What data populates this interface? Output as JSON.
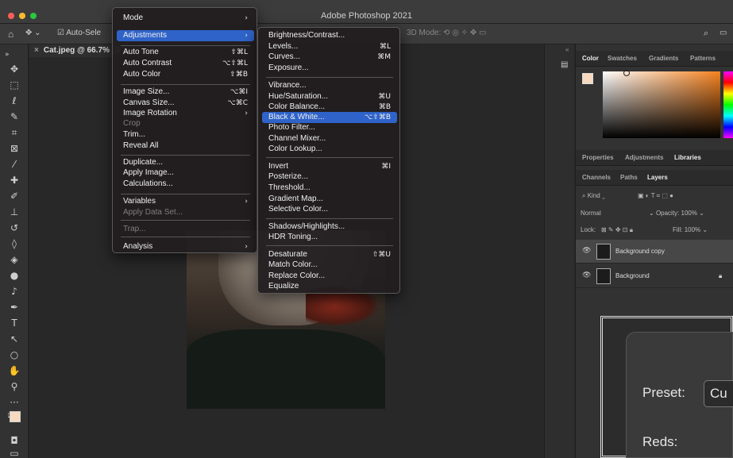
{
  "window": {
    "title": "Adobe Photoshop 2021"
  },
  "optionsbar": {
    "autoselect": "Auto-Sele",
    "mode3d": "3D Mode:"
  },
  "document": {
    "tab_title": "Cat.jpeg @ 66.7% (B"
  },
  "image_menu": {
    "items": [
      {
        "label": "Mode",
        "shortcut": "",
        "arrow": "›",
        "state": "normal"
      },
      {
        "label": "Adjustments",
        "shortcut": "",
        "arrow": "›",
        "state": "highlight"
      },
      {
        "label": "Auto Tone",
        "shortcut": "⇧⌘L",
        "arrow": "",
        "state": "normal"
      },
      {
        "label": "Auto Contrast",
        "shortcut": "⌥⇧⌘L",
        "arrow": "",
        "state": "normal"
      },
      {
        "label": "Auto Color",
        "shortcut": "⇧⌘B",
        "arrow": "",
        "state": "normal"
      },
      {
        "label": "Image Size...",
        "shortcut": "⌥⌘I",
        "arrow": "",
        "state": "normal"
      },
      {
        "label": "Canvas Size...",
        "shortcut": "⌥⌘C",
        "arrow": "",
        "state": "normal"
      },
      {
        "label": "Image Rotation",
        "shortcut": "",
        "arrow": "›",
        "state": "normal"
      },
      {
        "label": "Crop",
        "shortcut": "",
        "arrow": "",
        "state": "disabled"
      },
      {
        "label": "Trim...",
        "shortcut": "",
        "arrow": "",
        "state": "normal"
      },
      {
        "label": "Reveal All",
        "shortcut": "",
        "arrow": "",
        "state": "normal"
      },
      {
        "label": "Duplicate...",
        "shortcut": "",
        "arrow": "",
        "state": "normal"
      },
      {
        "label": "Apply Image...",
        "shortcut": "",
        "arrow": "",
        "state": "normal"
      },
      {
        "label": "Calculations...",
        "shortcut": "",
        "arrow": "",
        "state": "normal"
      },
      {
        "label": "Variables",
        "shortcut": "",
        "arrow": "›",
        "state": "normal"
      },
      {
        "label": "Apply Data Set...",
        "shortcut": "",
        "arrow": "",
        "state": "disabled"
      },
      {
        "label": "Trap...",
        "shortcut": "",
        "arrow": "",
        "state": "disabled"
      },
      {
        "label": "Analysis",
        "shortcut": "",
        "arrow": "›",
        "state": "normal"
      }
    ]
  },
  "adjustments_menu": {
    "items": [
      {
        "label": "Brightness/Contrast...",
        "shortcut": "",
        "state": "normal"
      },
      {
        "label": "Levels...",
        "shortcut": "⌘L",
        "state": "normal"
      },
      {
        "label": "Curves...",
        "shortcut": "⌘M",
        "state": "normal"
      },
      {
        "label": "Exposure...",
        "shortcut": "",
        "state": "normal"
      },
      {
        "label": "Vibrance...",
        "shortcut": "",
        "state": "normal"
      },
      {
        "label": "Hue/Saturation...",
        "shortcut": "⌘U",
        "state": "normal"
      },
      {
        "label": "Color Balance...",
        "shortcut": "⌘B",
        "state": "normal"
      },
      {
        "label": "Black & White...",
        "shortcut": "⌥⇧⌘B",
        "state": "highlight"
      },
      {
        "label": "Photo Filter...",
        "shortcut": "",
        "state": "normal"
      },
      {
        "label": "Channel Mixer...",
        "shortcut": "",
        "state": "normal"
      },
      {
        "label": "Color Lookup...",
        "shortcut": "",
        "state": "normal"
      },
      {
        "label": "Invert",
        "shortcut": "⌘I",
        "state": "normal"
      },
      {
        "label": "Posterize...",
        "shortcut": "",
        "state": "normal"
      },
      {
        "label": "Threshold...",
        "shortcut": "",
        "state": "normal"
      },
      {
        "label": "Gradient Map...",
        "shortcut": "",
        "state": "normal"
      },
      {
        "label": "Selective Color...",
        "shortcut": "",
        "state": "normal"
      },
      {
        "label": "Shadows/Highlights...",
        "shortcut": "",
        "state": "normal"
      },
      {
        "label": "HDR Toning...",
        "shortcut": "",
        "state": "normal"
      },
      {
        "label": "Desaturate",
        "shortcut": "⇧⌘U",
        "state": "normal"
      },
      {
        "label": "Match Color...",
        "shortcut": "",
        "state": "normal"
      },
      {
        "label": "Replace Color...",
        "shortcut": "",
        "state": "normal"
      },
      {
        "label": "Equalize",
        "shortcut": "",
        "state": "normal"
      }
    ]
  },
  "color_panel": {
    "tabs": [
      "Color",
      "Swatches",
      "Gradients",
      "Patterns"
    ],
    "foreground": "#f6d9bf"
  },
  "props_panel": {
    "tabs": [
      "Properties",
      "Adjustments",
      "Libraries"
    ]
  },
  "layers_panel": {
    "tabs": [
      "Channels",
      "Paths",
      "Layers"
    ],
    "filter_kind": "Kind",
    "blend_mode": "Normal",
    "opacity_label": "Opacity:",
    "opacity_value": "100%",
    "lock_label": "Lock:",
    "fill_label": "Fill:",
    "fill_value": "100%",
    "layers": [
      "Background copy",
      "Background"
    ]
  },
  "bw_dialog": {
    "preset_label": "Preset:",
    "preset_value": "Cu",
    "reds_label": "Reds:"
  }
}
